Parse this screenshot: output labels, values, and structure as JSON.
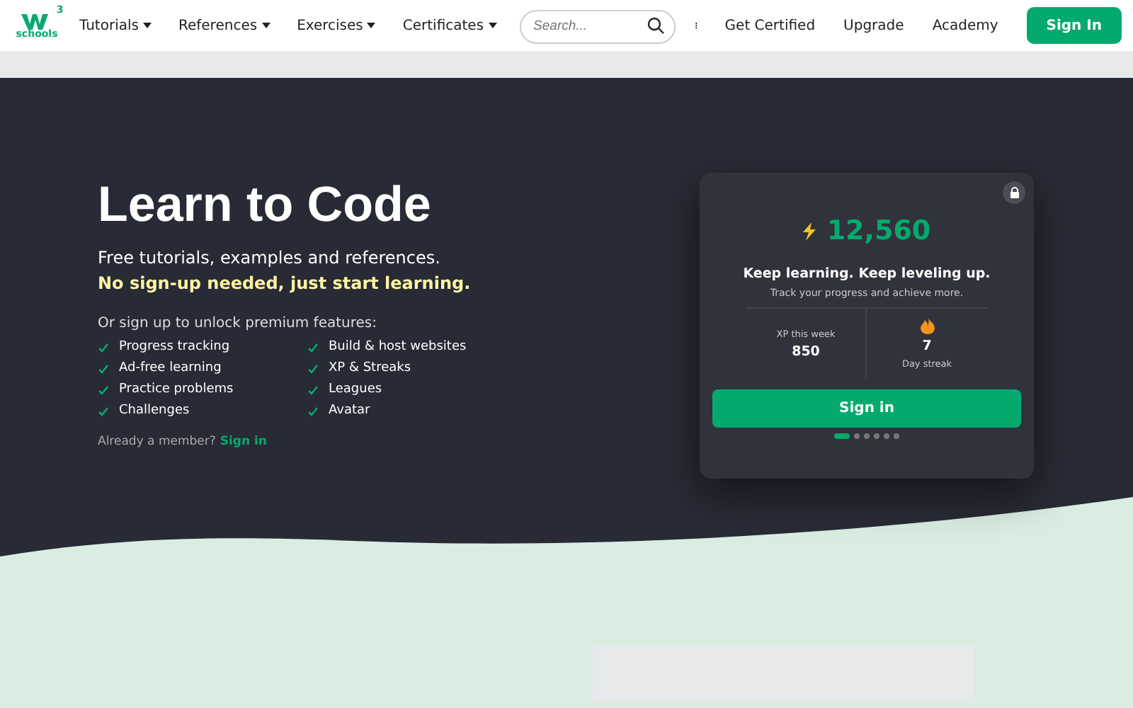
{
  "nav": {
    "logo": {
      "mark": "3",
      "text": "schools"
    },
    "menus": [
      {
        "label": "Tutorials"
      },
      {
        "label": "References"
      },
      {
        "label": "Exercises"
      },
      {
        "label": "Certificates"
      }
    ],
    "search": {
      "placeholder": "Search..."
    },
    "links": [
      "Get Certified",
      "Upgrade",
      "Academy"
    ],
    "sign_in": "Sign In"
  },
  "hero": {
    "title": "Learn to Code",
    "subtitle": "Free tutorials, examples and references.",
    "highlight": "No sign-up needed, just start learning.",
    "features_intro": "Or sign up to unlock premium features:",
    "features": [
      "Progress tracking",
      "Build & host websites",
      "Ad-free learning",
      "XP & Streaks",
      "Practice problems",
      "Leagues",
      "Challenges",
      "Avatar"
    ],
    "member_text": "Already a member?",
    "member_link": "Sign in"
  },
  "card": {
    "xp": "12,560",
    "headline": "Keep learning. Keep leveling up.",
    "subline": "Track your progress and achieve more.",
    "stats": [
      {
        "kind": "plain",
        "label": "XP this week",
        "value": "850"
      },
      {
        "kind": "streak",
        "label": "Day streak",
        "value": "7"
      }
    ],
    "button": "Sign in",
    "dots": [
      {
        "selected": true
      },
      {
        "selected": false
      },
      {
        "selected": false
      },
      {
        "selected": false
      },
      {
        "selected": false
      },
      {
        "selected": false
      }
    ]
  }
}
